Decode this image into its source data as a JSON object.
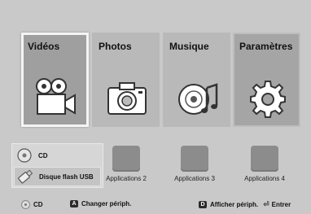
{
  "tiles": [
    {
      "label": "Vidéos",
      "icon": "video-camera-icon",
      "selected": true
    },
    {
      "label": "Photos",
      "icon": "camera-icon",
      "selected": false
    },
    {
      "label": "Musique",
      "icon": "music-disc-icon",
      "selected": false
    },
    {
      "label": "Paramètres",
      "icon": "gear-icon",
      "selected": false
    }
  ],
  "devices": [
    {
      "label": "CD",
      "icon": "cd-icon"
    },
    {
      "label": "Disque flash USB",
      "icon": "usb-drive-icon",
      "selected": true
    }
  ],
  "apps": [
    {
      "label": "Applications 2"
    },
    {
      "label": "Applications 3"
    },
    {
      "label": "Applications 4"
    }
  ],
  "footer": {
    "cd": "CD",
    "key_a": "A",
    "change_device": "Changer périph.",
    "key_d": "D",
    "show_device": "Afficher périph.",
    "enter": "Entrer"
  },
  "colors": {
    "background": "#c9c9c9",
    "tile": "#b9b9b9",
    "tile_selected": "#9f9f9f",
    "app_box": "#8c8c8c"
  }
}
